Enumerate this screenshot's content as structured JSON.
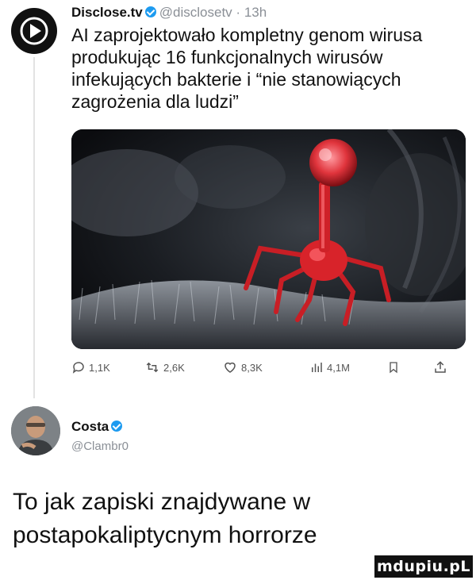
{
  "tweet": {
    "author_name": "Disclose.tv",
    "handle": "@disclosetv",
    "time": "13h",
    "separator": "·",
    "text": "AI zaprojektowało kompletny genom wirusa produkując 16 funkcjonalnych wirusów infekujących bakterie i “nie stanowiących zagrożenia dla ludzi”",
    "media_icon": "bacteriophage-image",
    "stats": {
      "replies": "1,1K",
      "reposts": "2,6K",
      "likes": "8,3K",
      "views": "4,1M"
    }
  },
  "reply": {
    "author_name": "Costa",
    "handle": "@Clambr0",
    "text": "To jak zapiski znajdywane w postapokaliptycnym horrorze"
  },
  "watermark": "mdupiu.pL",
  "colors": {
    "verified": "#1d9bf0",
    "handle_gray": "#8a8f96",
    "phage_red": "#d8232a"
  }
}
